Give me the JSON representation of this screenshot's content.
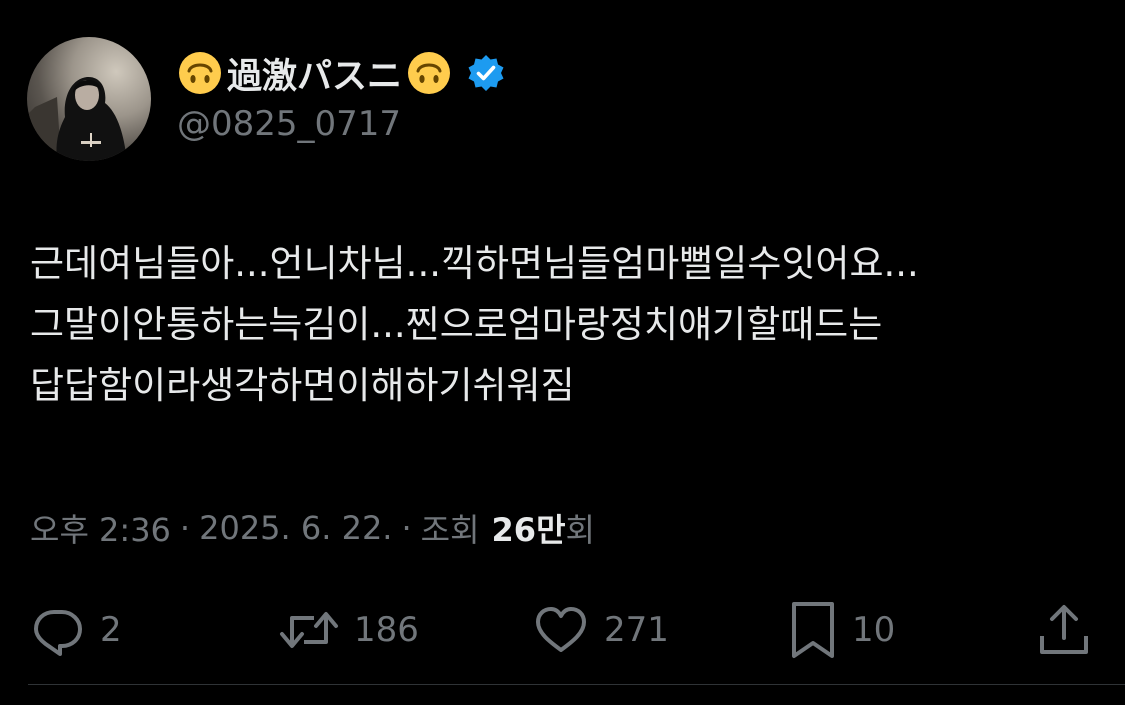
{
  "author": {
    "emoji_left": "upside-down-face-emoji",
    "display_name": "過激パスニ",
    "emoji_right": "upside-down-face-emoji",
    "verified": true,
    "handle": "@0825_0717"
  },
  "tweet": {
    "lines": [
      "근데여님들아...언니차님...끽하면님들엄마뻘일수잇어요...",
      "그말이안통하는늑김이...찐으로엄마랑정치얘기할때드는",
      "답답함이라생각하면이해하기쉬워짐"
    ]
  },
  "meta": {
    "time": "오후 2:36",
    "separator": "·",
    "date": "2025. 6. 22.",
    "views_prefix": "조회",
    "views_count": "26만",
    "views_suffix": "회"
  },
  "actions": {
    "reply": {
      "icon": "reply-icon",
      "count": "2"
    },
    "retweet": {
      "icon": "retweet-icon",
      "count": "186"
    },
    "like": {
      "icon": "heart-icon",
      "count": "271"
    },
    "bookmark": {
      "icon": "bookmark-icon",
      "count": "10"
    },
    "share": {
      "icon": "share-icon"
    }
  },
  "colors": {
    "background": "#000000",
    "text_primary": "#e7e9ea",
    "text_secondary": "#71767b",
    "verified_blue": "#1d9bf0",
    "emoji_yellow": "#ffcc4d",
    "divider": "#2f3336"
  }
}
